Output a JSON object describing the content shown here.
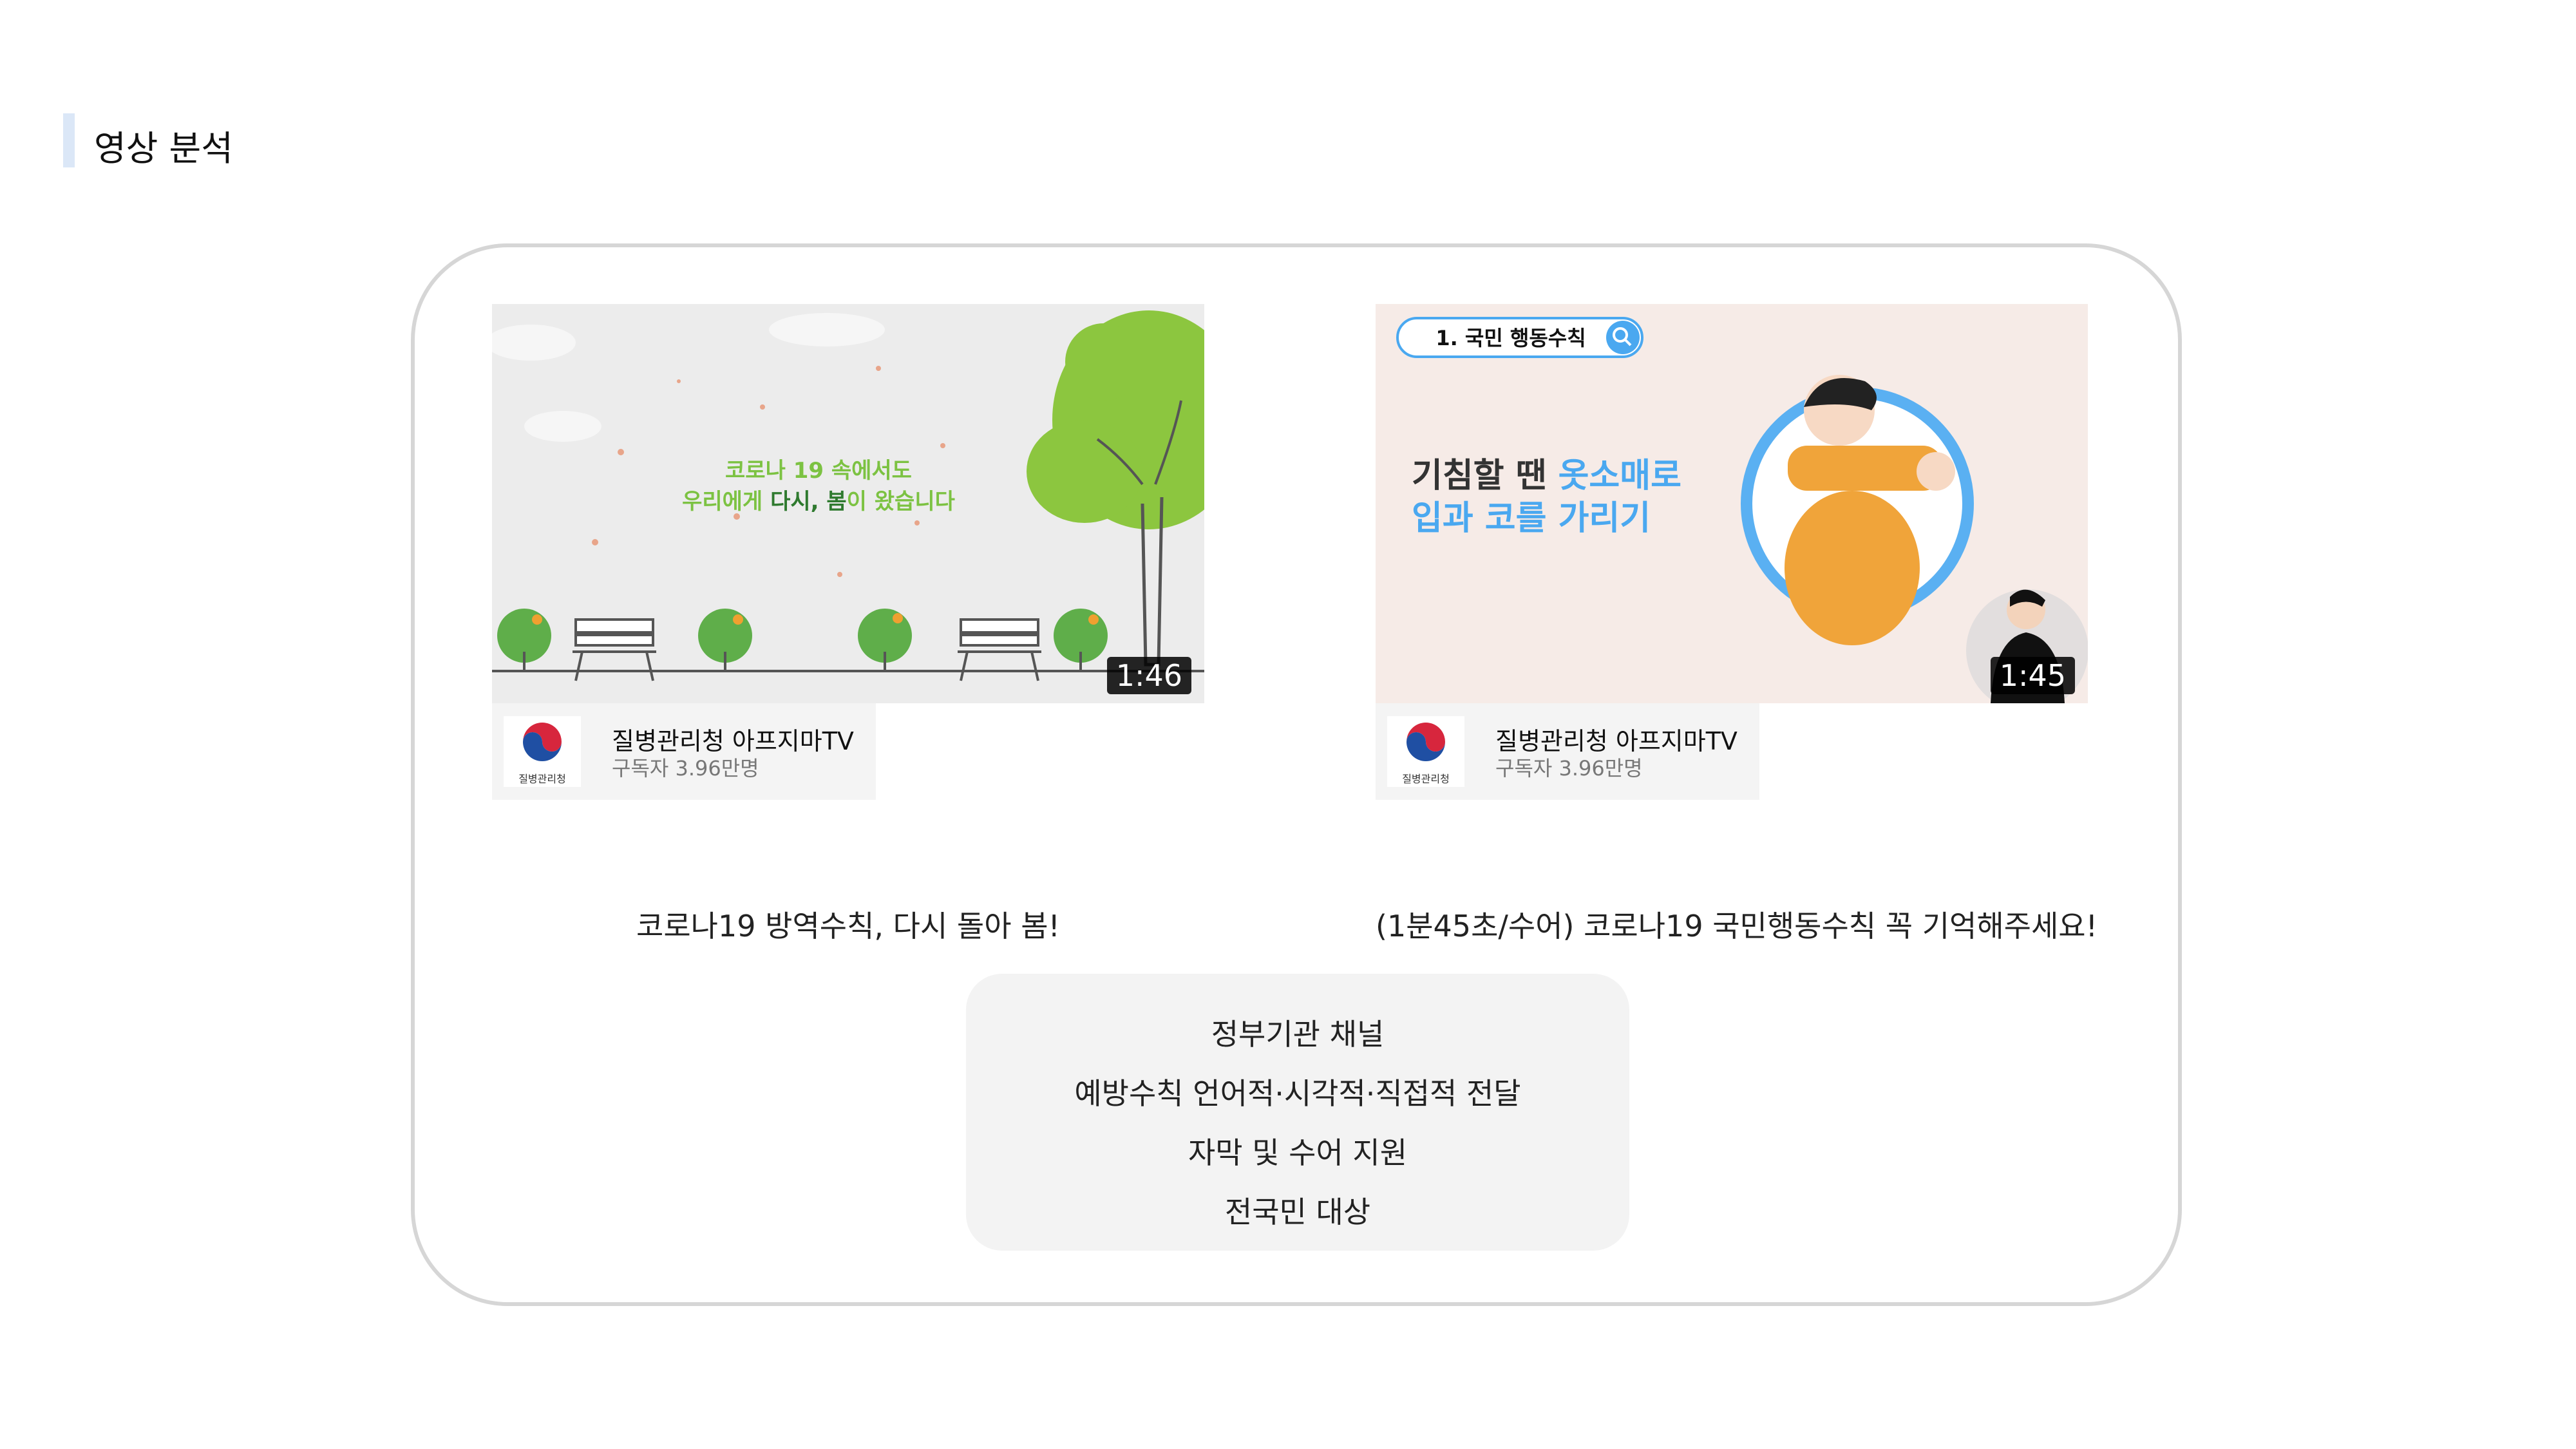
{
  "section": {
    "title": "영상 분석"
  },
  "videos": [
    {
      "duration": "1:46",
      "overlay_line1": "코로나 19 속에서도",
      "overlay_line2a": "우리에게 ",
      "overlay_line2b": "다시, 봄",
      "overlay_line2c": "이 왔습니다",
      "channel_name": "질병관리청 아프지마TV",
      "channel_subs": "구독자 3.96만명",
      "logo_caption": "질병관리청",
      "title": "코로나19 방역수칙, 다시 돌아 봄!"
    },
    {
      "duration": "1:45",
      "overlay_badge": "1. 국민 행동수칙",
      "overlay_line1a": "기침할 땐 ",
      "overlay_line1b": "옷소매로",
      "overlay_line2a": "입과 코를 ",
      "overlay_line2b": "가리기",
      "channel_name": "질병관리청 아프지마TV",
      "channel_subs": "구독자 3.96만명",
      "logo_caption": "질병관리청",
      "title": "(1분45초/수어) 코로나19 국민행동수칙 꼭 기억해주세요!"
    }
  ],
  "summary": [
    "정부기관 채널",
    "예방수칙 언어적·시각적·직접적 전달",
    "자막 및 수어 지원",
    "전국민 대상"
  ],
  "colors": {
    "accent_green": "#7cc242",
    "accent_blue": "#4aa8f0",
    "panel_border": "#d6d6d6"
  }
}
